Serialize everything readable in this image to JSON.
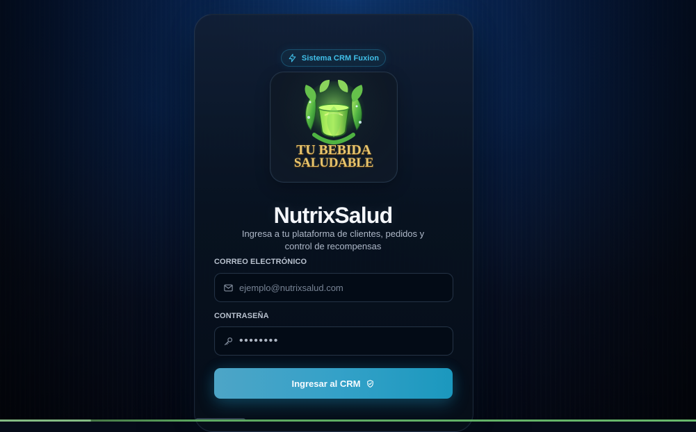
{
  "badge": {
    "label": "Sistema CRM Fuxion",
    "icon": "bolt-icon",
    "accent": "#41c1ea"
  },
  "logo": {
    "line_1": "TU BEBIDA",
    "line_2": "SALUDABLE",
    "icon": "green-drink-leaf-icon"
  },
  "brand": {
    "title": "NutrixSalud",
    "subtitle": "Ingresa a tu plataforma de clientes, pedidos y control de recompensas"
  },
  "form": {
    "email_label": "CORREO ELECTRÓNICO",
    "email_placeholder": "ejemplo@nutrixsalud.com",
    "email_icon": "mail-icon",
    "password_label": "CONTRASEÑA",
    "password_value": "••••••••",
    "password_icon": "key-icon",
    "submit_label": "Ingresar al CRM",
    "submit_icon": "shield-icon"
  },
  "colors": {
    "page_background": "#050b18",
    "card_background": "#0b1727",
    "button_accent": "#1b98be",
    "logo_text": "#e8c56c"
  }
}
